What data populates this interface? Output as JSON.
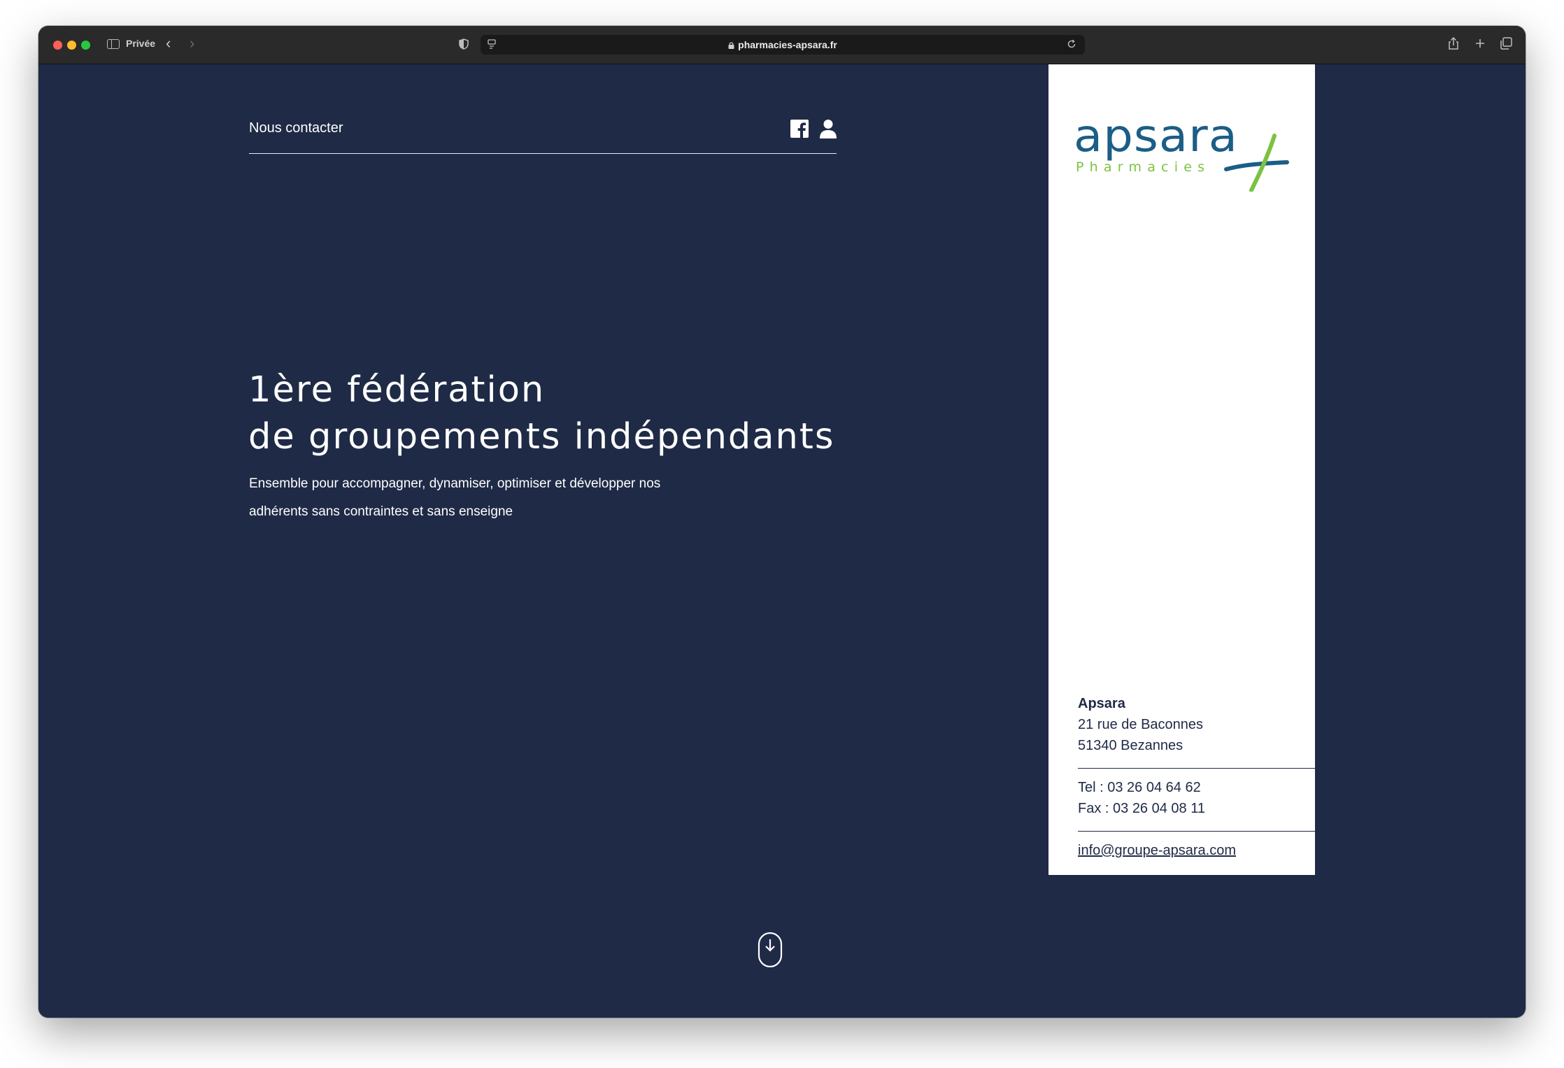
{
  "browser": {
    "private_label": "Privée",
    "url": "pharmacies-apsara.fr"
  },
  "nav": {
    "contact_label": "Nous contacter"
  },
  "hero": {
    "title_line1": "1ère fédération",
    "title_line2": "de groupements indépendants",
    "subtitle_line1": "Ensemble pour accompagner, dynamiser, optimiser et développer nos",
    "subtitle_line2": "adhérents sans contraintes et sans enseigne"
  },
  "card": {
    "logo_word": "apsara",
    "logo_sub": "Pharmacies",
    "company": "Apsara",
    "address_line1": "21 rue de Baconnes",
    "address_line2": "51340 Bezannes",
    "tel": "Tel : 03 26 04 64 62",
    "fax": "Fax : 03 26 04 08 11",
    "email": "info@groupe-apsara.com"
  },
  "colors": {
    "navy": "#1f2a46",
    "logo_blue": "#1b5e86",
    "logo_green": "#7cc242"
  },
  "icons": [
    "facebook-icon",
    "user-icon",
    "scroll-down-mouse-icon",
    "shield-icon",
    "lock-icon",
    "reload-icon",
    "share-icon",
    "plus-icon",
    "tabs-overview-icon"
  ]
}
